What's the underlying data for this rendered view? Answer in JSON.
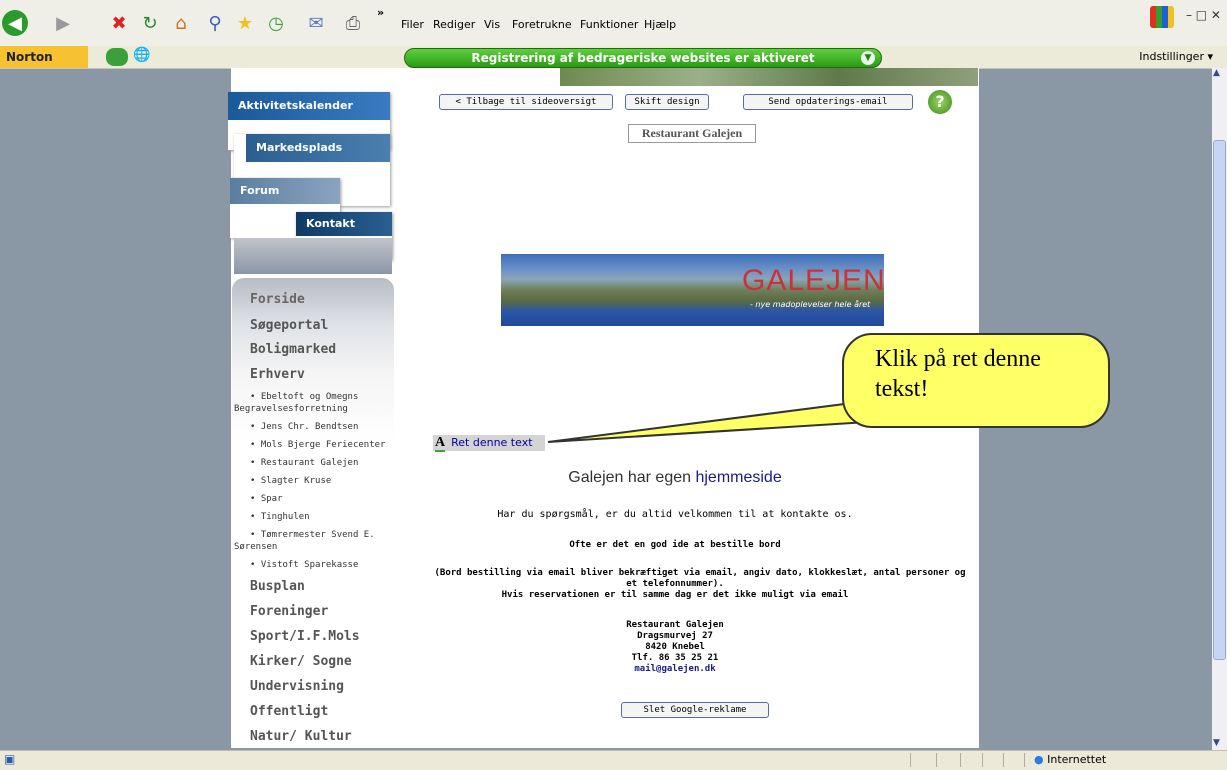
{
  "menu": {
    "filer": "Filer",
    "rediger": "Rediger",
    "vis": "Vis",
    "foretrukne": "Foretrukne",
    "funktioner": "Funktioner",
    "hjaelp": "Hjælp",
    "more": "»"
  },
  "norton": {
    "logo": "Norton",
    "message": "Registrering af bedrageriske websites er aktiveret",
    "settings": "Indstillinger"
  },
  "tabs": {
    "aktivitetskalender": "Aktivitetskalender",
    "markedsplads": "Markedsplads",
    "forum": "Forum",
    "kontakt": "Kontakt"
  },
  "nav": {
    "forside": "Forside",
    "soegeportal": "Søgeportal",
    "boligmarked": "Boligmarked",
    "erhverv": "Erhverv",
    "sub": [
      "• Ebeltoft og Omegns",
      "Begravelsesforretning",
      "• Jens Chr. Bendtsen",
      "• Mols Bjerge Feriecenter",
      "• Restaurant Galejen",
      "• Slagter Kruse",
      "• Spar",
      "• Tinghulen",
      "• Tømrermester Svend E.",
      "Sørensen",
      "• Vistoft Sparekasse"
    ],
    "busplan": "Busplan",
    "foreninger": "Foreninger",
    "sport": "Sport/I.F.Mols",
    "kirker": "Kirker/ Sogne",
    "undervisning": "Undervisning",
    "offentligt": "Offentligt",
    "natur": "Natur/ Kultur"
  },
  "buttons": {
    "back": "< Tilbage til sideoversigt",
    "design": "Skift design",
    "email": "Send opdaterings-email",
    "help": "?",
    "slet": "Slet Google-reklame"
  },
  "page_title": "Restaurant Galejen",
  "banner": {
    "title": "GALEJEN",
    "subtitle": "- nye madoplevelser hele året"
  },
  "callout": "Klik på ret denne tekst!",
  "ret": {
    "icon": "A",
    "label": "Ret denne text"
  },
  "content": {
    "heading": "Galejen har egen ",
    "heading_link": "hjemmeside",
    "welcome": "Har du spørgsmål, er du altid velkommen til at kontakte os.",
    "tip": "Ofte er det en god ide at bestille bord",
    "note1": "(Bord bestilling via email bliver bekræftiget via email, angiv dato, klokkeslæt, antal personer og",
    "note2": "et telefonnummer).",
    "note3": "Hvis reservationen er til samme dag er det ikke muligt via email",
    "addr1": "Restaurant Galejen",
    "addr2": "Dragsmurvej 27",
    "addr3": "8420 Knebel",
    "phone": "Tlf. 86 35 25 21",
    "email": "mail@galejen.dk"
  },
  "status": {
    "zone": "Internettet"
  }
}
